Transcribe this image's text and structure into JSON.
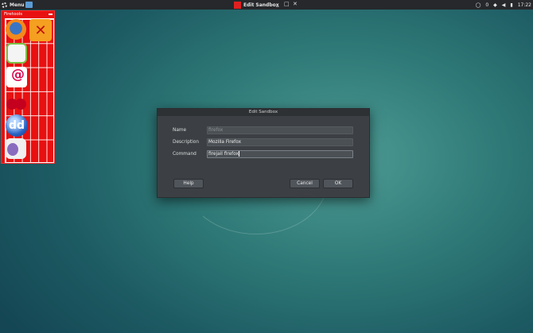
{
  "topbar": {
    "menu_label": "Menu",
    "task_label": "Edit Sandbox",
    "win_min": "_",
    "win_max": "□",
    "win_close": "✕",
    "tray_count": "0",
    "clock": "17:22"
  },
  "firetools": {
    "title": "Firetools",
    "apps": [
      "firefox-icon",
      "xchat-icon",
      "chat-icon",
      "debian-icon",
      "cherrytree-icon",
      "ddg-icon",
      "pidgin-icon"
    ]
  },
  "dialog": {
    "title": "Edit Sandbox",
    "fields": [
      {
        "label": "Name",
        "value": "firefox"
      },
      {
        "label": "Description",
        "value": "Mozilla Firefox"
      },
      {
        "label": "Command",
        "value": "firejail firefox"
      }
    ],
    "help_label": "Help",
    "cancel_label": "Cancel",
    "ok_label": "OK"
  },
  "colors": {
    "launcher_red": "#e81010",
    "dialog_bg": "#3c4044",
    "desktop_teal": "#2f7a78"
  }
}
